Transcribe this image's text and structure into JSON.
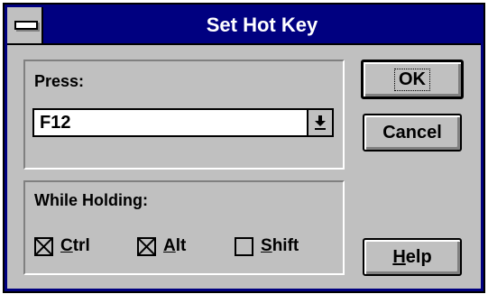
{
  "window": {
    "title": "Set Hot Key"
  },
  "press_group": {
    "label": "Press:",
    "key_value": "F12"
  },
  "holding_group": {
    "label": "While Holding:",
    "ctrl": {
      "mnemonic": "C",
      "rest": "trl",
      "checked": true
    },
    "alt": {
      "mnemonic": "A",
      "rest": "lt",
      "checked": true
    },
    "shift": {
      "mnemonic": "S",
      "rest": "hift",
      "checked": false
    }
  },
  "buttons": {
    "ok": "OK",
    "cancel": "Cancel",
    "help_mnemonic": "H",
    "help_rest": "elp"
  },
  "icons": [
    "system-menu-icon",
    "dropdown-arrow-icon",
    "checkbox-checked-icon",
    "checkbox-unchecked-icon"
  ]
}
